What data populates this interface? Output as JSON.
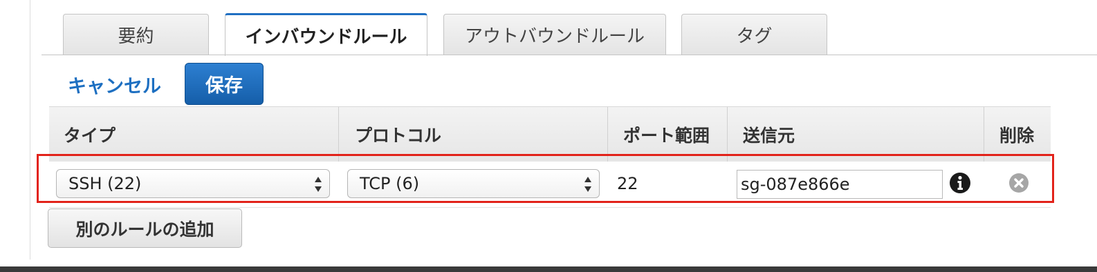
{
  "tabs": [
    {
      "label": "要約",
      "active": false
    },
    {
      "label": "インバウンドルール",
      "active": true
    },
    {
      "label": "アウトバウンドルール",
      "active": false
    },
    {
      "label": "タグ",
      "active": false
    }
  ],
  "actions": {
    "cancel_label": "キャンセル",
    "save_label": "保存"
  },
  "table": {
    "columns": [
      "タイプ",
      "プロトコル",
      "ポート範囲",
      "送信元",
      "削除"
    ],
    "rows": [
      {
        "type": "SSH (22)",
        "protocol": "TCP (6)",
        "port_range": "22",
        "source": "sg-087e866e"
      }
    ]
  },
  "add_rule_label": "別のルールの追加",
  "icons": {
    "info": "info-icon",
    "remove": "remove-row-icon",
    "select_arrows": "select-arrows-icon"
  },
  "colors": {
    "accent": "#1d6fc1",
    "highlight": "#e2231a"
  }
}
